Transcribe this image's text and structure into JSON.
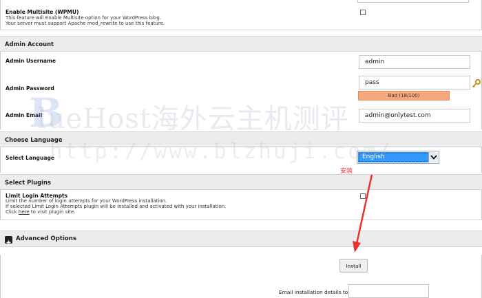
{
  "multisite": {
    "title": "Enable Multisite (WPMU)",
    "desc_line1": "This feature will Enable Multisite option for your WordPress blog.",
    "desc_line2": "Your server must support Apache mod_rewrite to use this feature."
  },
  "admin_account": {
    "heading": "Admin Account",
    "username_label": "Admin Username",
    "username_value": "admin",
    "password_label": "Admin Password",
    "password_value": "pass",
    "strength_text": "Bad (18/100)",
    "email_label": "Admin Email",
    "email_value": "admin@onlytest.com"
  },
  "language": {
    "heading": "Choose Language",
    "select_label": "Select Language",
    "selected": "English"
  },
  "plugins": {
    "heading": "Select Plugins",
    "limit_title": "Limit Login Attempts",
    "limit_desc1": "Limit the number of login attempts for your WordPress installation.",
    "limit_desc2": "If selected Limit Login Attempts plugin will be installed and activated with your installation.",
    "limit_desc3_pre": "Click ",
    "limit_desc3_link": "here",
    "limit_desc3_post": " to visit plugin site."
  },
  "advanced": {
    "label": "Advanced Options"
  },
  "install": {
    "button": "Install",
    "email_label": "Email installation details to :"
  },
  "annotation": {
    "text": "安装",
    "color": "#e8322d"
  },
  "watermark": {
    "b": "B",
    "text": "lueHost海外云主机测评",
    "url": "http://www.blzhuji.com/"
  },
  "colors": {
    "section_bg": "#ececec",
    "strength_bad": "#f7a77c",
    "select_highlight": "#3399ff"
  },
  "icons": [
    "key-icon",
    "chevron-down-icon",
    "plus-icon",
    "arrow-annotation"
  ]
}
